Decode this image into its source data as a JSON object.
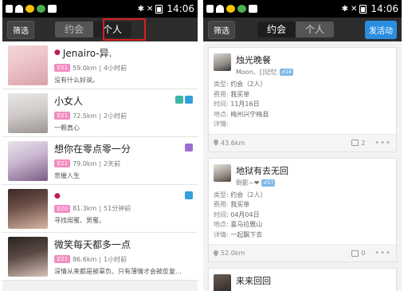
{
  "left": {
    "statusbar": {
      "time": "14:06"
    },
    "topbar": {
      "filter_label": "筛选",
      "tab1": "约会",
      "tab2": "个人"
    },
    "users": [
      {
        "name": "Jenairo-异.",
        "age": "21",
        "distance": "59.0km",
        "time_ago": "4小时前",
        "signature": "没有什么好说。"
      },
      {
        "name": "小女人",
        "age": "21",
        "distance": "72.5km",
        "time_ago": "2小时前",
        "signature": "一颗真心"
      },
      {
        "name": "想你在零点零一分",
        "age": "21",
        "distance": "79.0km",
        "time_ago": "2天前",
        "signature": "悲催人生"
      },
      {
        "name": "",
        "age": "20",
        "distance": "81.3km",
        "time_ago": "51分钟前",
        "signature": "寻找闺蜜、男蜜。"
      },
      {
        "name": "微笑每天都多一点",
        "age": "21",
        "distance": "86.6km",
        "time_ago": "1小时前",
        "signature": "深情从来都是被辜负、只有薄情才会被反复..."
      }
    ]
  },
  "right": {
    "statusbar": {
      "time": "14:06"
    },
    "topbar": {
      "filter_label": "筛选",
      "tab1": "约会",
      "tab2": "个人",
      "publish_label": "发活动"
    },
    "labels": {
      "type": "类型:",
      "fee": "费用:",
      "time": "时间:",
      "place": "地点:",
      "detail": "详情:"
    },
    "events": [
      {
        "title": "烛光晚餐",
        "author": "Moon、[]记忆",
        "age": "24",
        "type": "约会（2人）",
        "fee": "我买单",
        "time": "11月16日",
        "place": "梅州兴宁梅县",
        "detail": "",
        "distance": "43.6km",
        "comments": "2"
      },
      {
        "title": "地狱有去无回",
        "author": "倒影~❤",
        "age": "27",
        "type": "约会（2人）",
        "fee": "我买单",
        "time": "04月04日",
        "place": "喜马拉雅山",
        "detail": "一起飘下去",
        "distance": "52.0km",
        "comments": "0"
      },
      {
        "title": "来来回回",
        "author": "",
        "age": "",
        "type": "",
        "fee": "",
        "time": "",
        "place": "",
        "detail": "",
        "distance": "",
        "comments": ""
      }
    ]
  },
  "colors": {
    "accent": "#2a8ee0",
    "highlight": "#d91d1d",
    "age_badge": "#f38bc1"
  }
}
